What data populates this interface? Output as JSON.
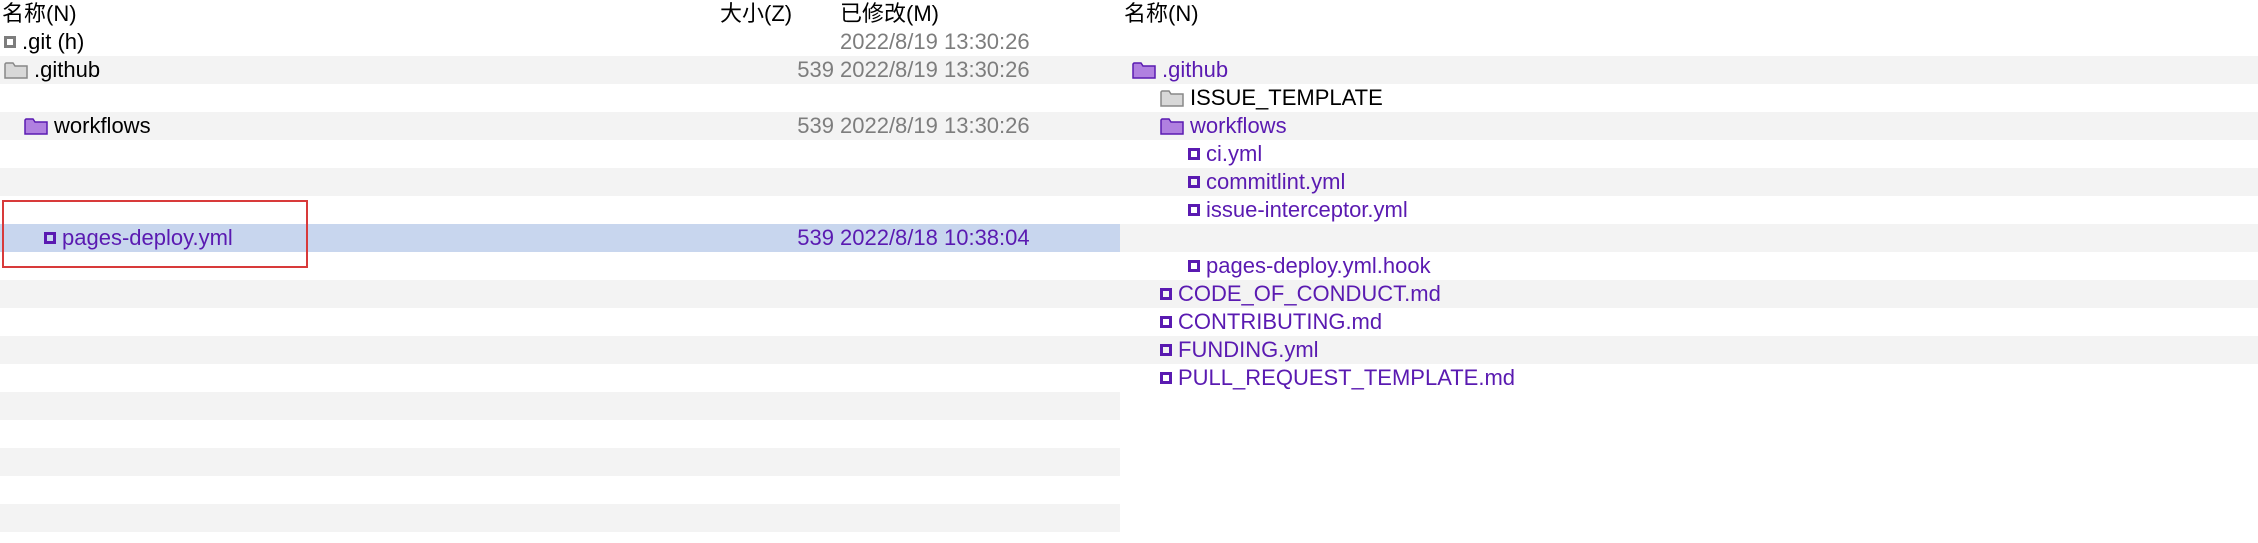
{
  "left": {
    "headers": {
      "name": "名称(N)",
      "size": "大小(Z)",
      "modified": "已修改(M)"
    },
    "rows": [
      {
        "type": "square-grey",
        "indent": 0,
        "name": ".git (h)",
        "size": "",
        "modified": "2022/8/19 13:30:26",
        "selected": false
      },
      {
        "type": "folder-grey",
        "indent": 0,
        "name": ".github",
        "size": "539",
        "modified": "2022/8/19 13:30:26",
        "selected": false
      },
      {
        "type": "spacer"
      },
      {
        "type": "folder-purple",
        "indent": 1,
        "name": "workflows",
        "size": "539",
        "modified": "2022/8/19 13:30:26",
        "selected": false
      },
      {
        "type": "spacer"
      },
      {
        "type": "spacer"
      },
      {
        "type": "spacer"
      },
      {
        "type": "square-purple",
        "indent": 2,
        "name": "pages-deploy.yml",
        "size": "539",
        "modified": "2022/8/18 10:38:04",
        "selected": true
      },
      {
        "type": "spacer"
      },
      {
        "type": "spacer"
      },
      {
        "type": "spacer"
      },
      {
        "type": "spacer"
      },
      {
        "type": "spacer"
      },
      {
        "type": "spacer"
      },
      {
        "type": "spacer"
      },
      {
        "type": "spacer"
      },
      {
        "type": "spacer"
      },
      {
        "type": "spacer"
      }
    ]
  },
  "right": {
    "headers": {
      "name": "名称(N)"
    },
    "tree": [
      {
        "type": "spacer"
      },
      {
        "type": "folder-purple",
        "indent": 1,
        "name": ".github"
      },
      {
        "type": "folder-grey",
        "indent": 2,
        "name": "ISSUE_TEMPLATE"
      },
      {
        "type": "folder-purple",
        "indent": 2,
        "name": "workflows"
      },
      {
        "type": "square-purple",
        "indent": 3,
        "name": "ci.yml"
      },
      {
        "type": "square-purple",
        "indent": 3,
        "name": "commitlint.yml"
      },
      {
        "type": "square-purple",
        "indent": 3,
        "name": "issue-interceptor.yml"
      },
      {
        "type": "spacer-indent3"
      },
      {
        "type": "square-purple",
        "indent": 3,
        "name": "pages-deploy.yml.hook"
      },
      {
        "type": "square-purple",
        "indent": 2,
        "name": "CODE_OF_CONDUCT.md"
      },
      {
        "type": "square-purple",
        "indent": 2,
        "name": "CONTRIBUTING.md"
      },
      {
        "type": "square-purple",
        "indent": 2,
        "name": "FUNDING.yml"
      },
      {
        "type": "square-purple",
        "indent": 2,
        "name": "PULL_REQUEST_TEMPLATE.md"
      }
    ]
  },
  "colors": {
    "purple": "#5a1ab1",
    "grey": "#7d7d7d",
    "selectedBg": "#c8d6ee",
    "highlight": "#d83a3a"
  }
}
